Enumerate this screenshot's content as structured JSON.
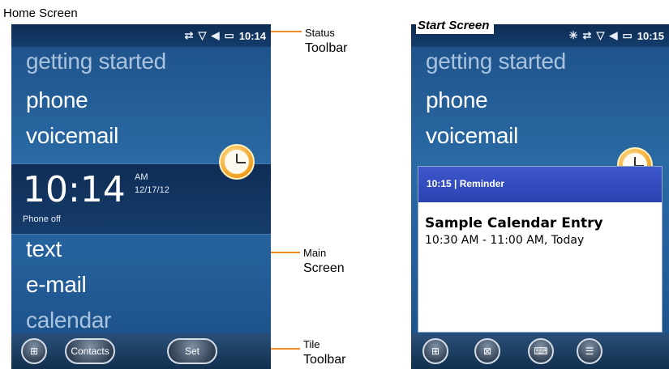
{
  "captions": {
    "home": "Home Screen",
    "start": "Start Screen"
  },
  "home": {
    "status": {
      "time": "10:14"
    },
    "menu_top": [
      "getting started",
      "phone",
      "voicemail"
    ],
    "clock": {
      "time": "10:14",
      "ampm": "AM",
      "date": "12/17/12",
      "phone_status": "Phone off"
    },
    "menu_bottom": [
      "text",
      "e-mail",
      "calendar"
    ],
    "toolbar": {
      "contacts": "Contacts",
      "set": "Set"
    }
  },
  "start": {
    "status": {
      "time": "10:15"
    },
    "menu_top": [
      "getting started",
      "phone",
      "voicemail"
    ],
    "reminder": {
      "header": "10:15 | Reminder",
      "title": "Sample Calendar Entry",
      "time": "10:30 AM - 11:00 AM, Today"
    }
  },
  "callouts": {
    "status": [
      "Status",
      "Toolbar"
    ],
    "main": [
      "Main",
      "Screen"
    ],
    "tile": [
      "Tile",
      "Toolbar"
    ]
  },
  "accent": "#f08a24"
}
